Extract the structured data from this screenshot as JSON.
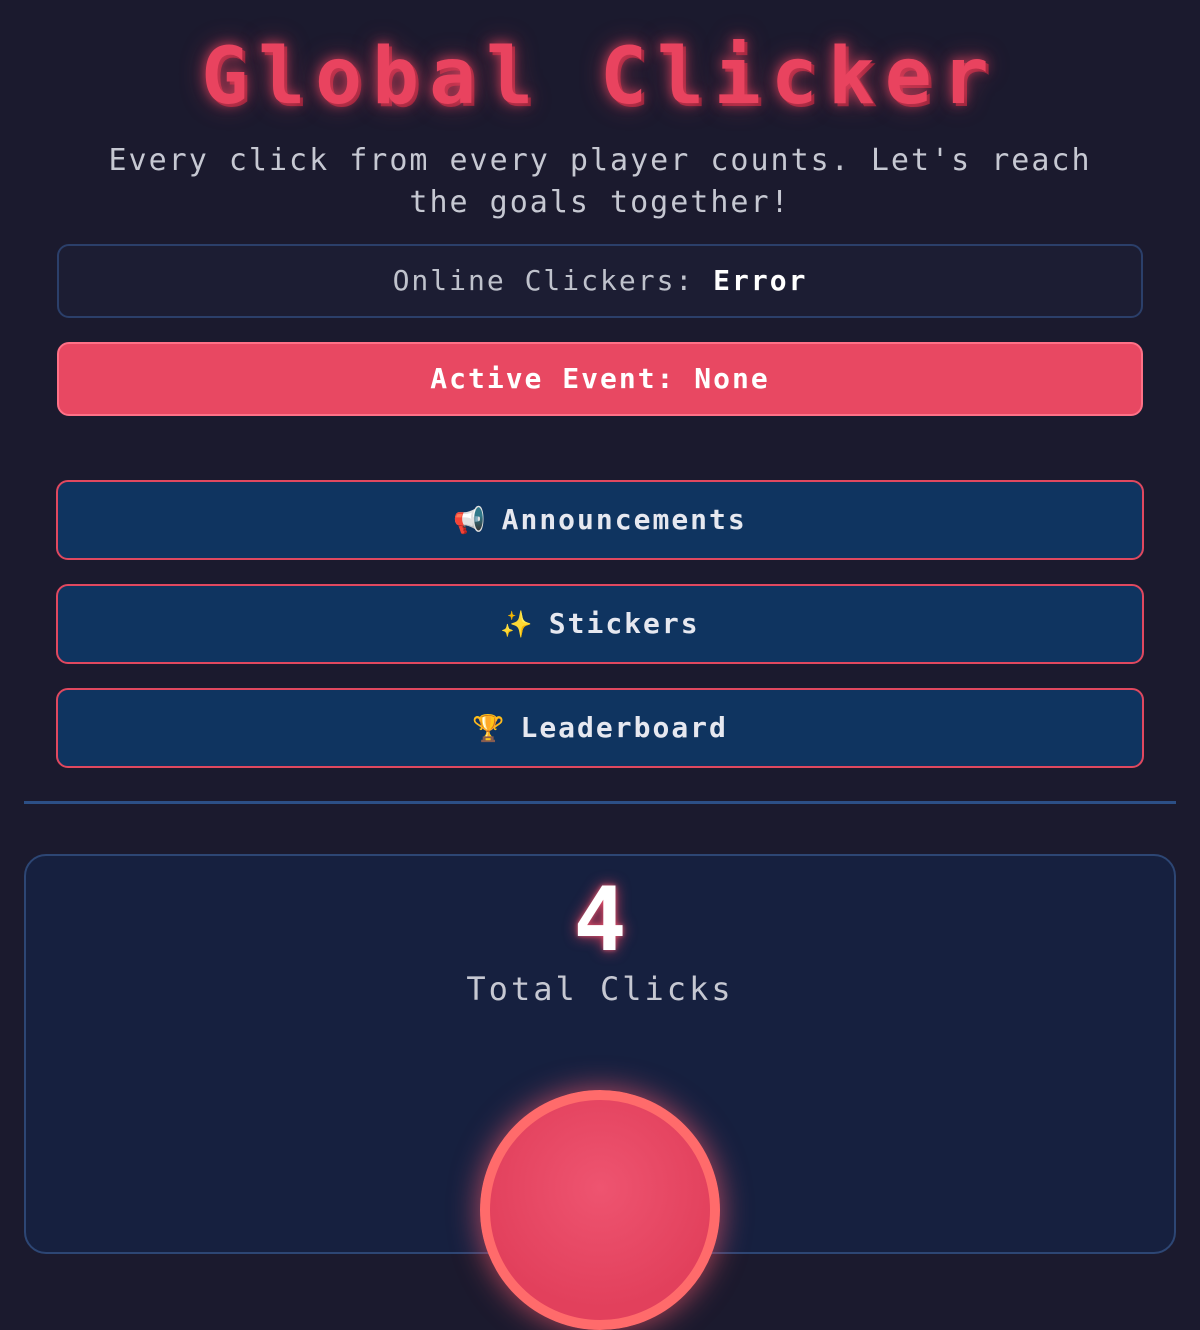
{
  "header": {
    "title": "Global Clicker",
    "subtitle": "Every click from every player counts. Let's reach the goals together!"
  },
  "status": {
    "online_label": "Online Clickers:",
    "online_value": "Error",
    "event_label": "Active Event:",
    "event_value": "None"
  },
  "nav": {
    "announcements": {
      "icon": "megaphone-icon",
      "glyph": "📢",
      "label": "Announcements"
    },
    "stickers": {
      "icon": "sparkles-icon",
      "glyph": "✨",
      "label": "Stickers"
    },
    "leaderboard": {
      "icon": "trophy-icon",
      "glyph": "🏆",
      "label": "Leaderboard"
    }
  },
  "counter": {
    "value": "4",
    "label": "Total Clicks"
  },
  "colors": {
    "background": "#1b1a2e",
    "accent": "#e9435f",
    "button_bg": "#0f3460",
    "panel_border": "#2c4f86"
  }
}
